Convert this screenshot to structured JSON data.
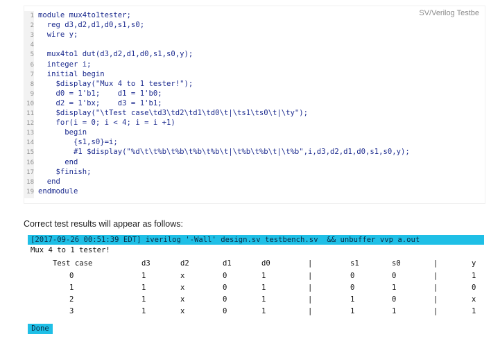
{
  "editor": {
    "language_label": "SV/Verilog Testbe",
    "lines": [
      {
        "n": "1",
        "text": "module mux4to1tester;"
      },
      {
        "n": "2",
        "text": "  reg d3,d2,d1,d0,s1,s0;"
      },
      {
        "n": "3",
        "text": "  wire y;"
      },
      {
        "n": "4",
        "text": ""
      },
      {
        "n": "5",
        "text": "  mux4to1 dut(d3,d2,d1,d0,s1,s0,y);"
      },
      {
        "n": "6",
        "text": "  integer i;"
      },
      {
        "n": "7",
        "text": "  initial begin"
      },
      {
        "n": "8",
        "text": "    $display(\"Mux 4 to 1 tester!\");"
      },
      {
        "n": "9",
        "text": "    d0 = 1'b1;    d1 = 1'b0;"
      },
      {
        "n": "10",
        "text": "    d2 = 1'bx;    d3 = 1'b1;"
      },
      {
        "n": "11",
        "text": "    $display(\"\\tTest case\\td3\\td2\\td1\\td0\\t|\\ts1\\ts0\\t|\\ty\");"
      },
      {
        "n": "12",
        "text": "    for(i = 0; i < 4; i = i +1)"
      },
      {
        "n": "13",
        "text": "      begin"
      },
      {
        "n": "14",
        "text": "        {s1,s0}=i;"
      },
      {
        "n": "15",
        "text": "        #1 $display(\"%d\\t\\t%b\\t%b\\t%b\\t%b\\t|\\t%b\\t%b\\t|\\t%b\",i,d3,d2,d1,d0,s1,s0,y);"
      },
      {
        "n": "16",
        "text": "      end"
      },
      {
        "n": "17",
        "text": "    $finish;"
      },
      {
        "n": "18",
        "text": "  end"
      },
      {
        "n": "19",
        "text": "endmodule"
      }
    ]
  },
  "note": "Correct test results will appear as follows:",
  "console": {
    "command": "[2017-09-26 00:51:39 EDT] iverilog '-Wall' design.sv testbench.sv  && unbuffer vvp a.out",
    "banner": "Mux 4 to 1 tester!",
    "headers": [
      "Test case",
      "d3",
      "d2",
      "d1",
      "d0",
      "|",
      "s1",
      "s0",
      "|",
      "y"
    ],
    "rows": [
      [
        "0",
        "1",
        "x",
        "0",
        "1",
        "|",
        "0",
        "0",
        "|",
        "1"
      ],
      [
        "1",
        "1",
        "x",
        "0",
        "1",
        "|",
        "0",
        "1",
        "|",
        "0"
      ],
      [
        "2",
        "1",
        "x",
        "0",
        "1",
        "|",
        "1",
        "0",
        "|",
        "x"
      ],
      [
        "3",
        "1",
        "x",
        "0",
        "1",
        "|",
        "1",
        "1",
        "|",
        "1"
      ]
    ],
    "done_label": "Done"
  }
}
